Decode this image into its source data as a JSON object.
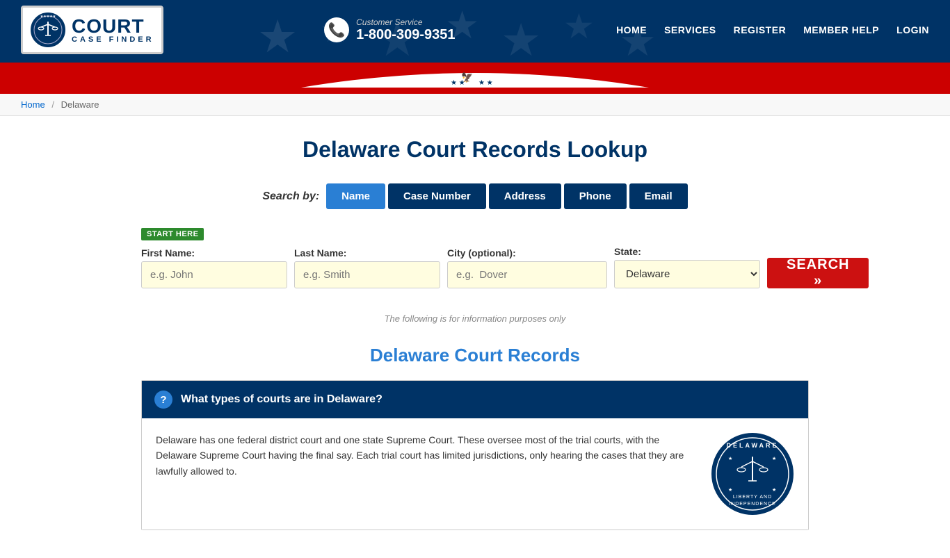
{
  "header": {
    "logo_court": "COURT",
    "logo_case_finder": "CASE FINDER",
    "customer_service_label": "Customer Service",
    "customer_service_phone": "1-800-309-9351",
    "nav": [
      {
        "label": "HOME",
        "href": "#"
      },
      {
        "label": "SERVICES",
        "href": "#"
      },
      {
        "label": "REGISTER",
        "href": "#"
      },
      {
        "label": "MEMBER HELP",
        "href": "#"
      },
      {
        "label": "LOGIN",
        "href": "#"
      }
    ]
  },
  "breadcrumb": {
    "home_label": "Home",
    "separator": "/",
    "current": "Delaware"
  },
  "main": {
    "page_title": "Delaware Court Records Lookup",
    "search_by_label": "Search by:",
    "search_tabs": [
      {
        "label": "Name",
        "active": true
      },
      {
        "label": "Case Number",
        "active": false
      },
      {
        "label": "Address",
        "active": false
      },
      {
        "label": "Phone",
        "active": false
      },
      {
        "label": "Email",
        "active": false
      }
    ],
    "start_here": "START HERE",
    "form": {
      "first_name_label": "First Name:",
      "first_name_placeholder": "e.g. John",
      "last_name_label": "Last Name:",
      "last_name_placeholder": "e.g. Smith",
      "city_label": "City (optional):",
      "city_placeholder": "e.g.  Dover",
      "state_label": "State:",
      "state_value": "Delaware",
      "search_button": "SEARCH »"
    },
    "info_note": "The following is for information purposes only",
    "section_heading": "Delaware Court Records",
    "faq": [
      {
        "question": "What types of courts are in Delaware?",
        "answer": "Delaware has one federal district court and one state Supreme Court. These oversee most of the trial courts, with the Delaware Supreme Court having the final say. Each trial court has limited jurisdictions, only hearing the cases that they are lawfully allowed to."
      }
    ]
  },
  "colors": {
    "navy": "#003366",
    "red": "#cc1111",
    "blue_accent": "#2a7fd4",
    "green_badge": "#2d8a2d",
    "input_bg": "#fffde0"
  }
}
